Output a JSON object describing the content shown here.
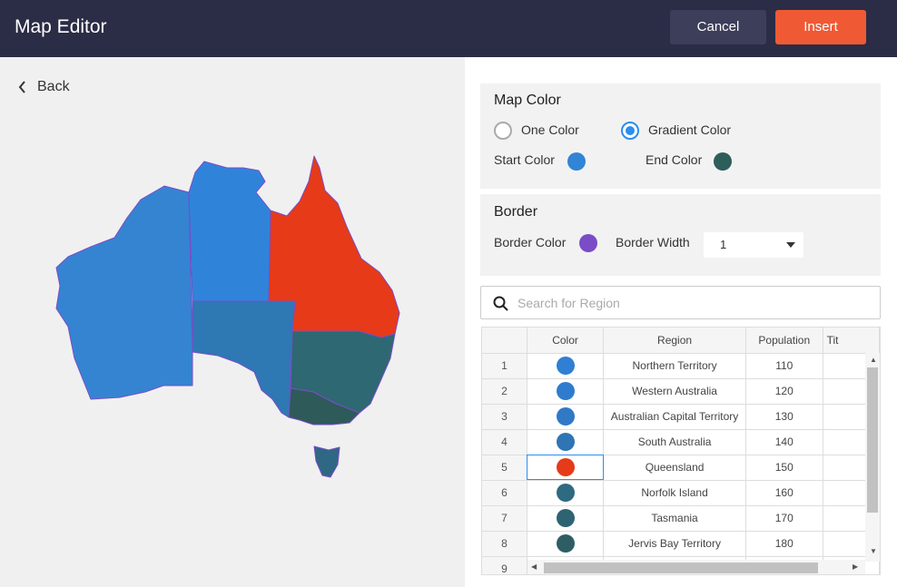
{
  "header": {
    "title": "Map Editor",
    "cancel_label": "Cancel",
    "insert_label": "Insert"
  },
  "left": {
    "back_label": "Back"
  },
  "map_color": {
    "title": "Map Color",
    "one_color_label": "One Color",
    "gradient_color_label": "Gradient Color",
    "selected": "Gradient Color",
    "start_color_label": "Start Color",
    "start_color": "#3284d6",
    "end_color_label": "End Color",
    "end_color": "#2e5e5a"
  },
  "border": {
    "title": "Border",
    "border_color_label": "Border Color",
    "border_color": "#7a4cc8",
    "border_width_label": "Border Width",
    "border_width_value": "1"
  },
  "search": {
    "placeholder": "Search for Region"
  },
  "table": {
    "columns": [
      "Color",
      "Region",
      "Population",
      "Tit"
    ],
    "rows": [
      {
        "n": "1",
        "color": "#2f7fd4",
        "region": "Northern Territory",
        "population": "110"
      },
      {
        "n": "2",
        "color": "#2f7cce",
        "region": "Western Australia",
        "population": "120"
      },
      {
        "n": "3",
        "color": "#3079c6",
        "region": "Australian Capital Territory",
        "population": "130"
      },
      {
        "n": "4",
        "color": "#2f74b4",
        "region": "South Australia",
        "population": "140"
      },
      {
        "n": "5",
        "color": "#e63a19",
        "region": "Queensland",
        "population": "150"
      },
      {
        "n": "6",
        "color": "#2e6a82",
        "region": "Norfolk Island",
        "population": "160"
      },
      {
        "n": "7",
        "color": "#2e6472",
        "region": "Tasmania",
        "population": "170"
      },
      {
        "n": "8",
        "color": "#2e5e64",
        "region": "Jervis Bay Territory",
        "population": "180"
      },
      {
        "n": "9",
        "color": "#2e5a5a",
        "region": "",
        "population": ""
      }
    ]
  },
  "map_regions": {
    "western_australia": "#3484d2",
    "northern_territory": "#2f84da",
    "queensland": "#e63a19",
    "south_australia": "#2e78b4",
    "new_south_wales": "#2e6872",
    "victoria": "#2e5a5a",
    "tasmania": "#2e6884"
  }
}
